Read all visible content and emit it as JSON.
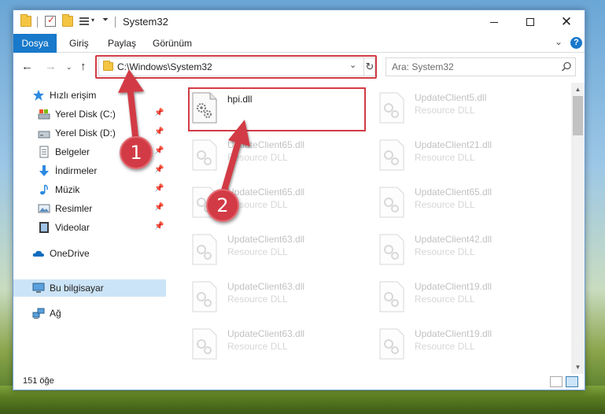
{
  "window": {
    "title": "System32"
  },
  "ribbon": {
    "tabs": [
      "Dosya",
      "Giriş",
      "Paylaş",
      "Görünüm"
    ]
  },
  "address": {
    "path": "C:\\Windows\\System32"
  },
  "search": {
    "placeholder": "Ara: System32"
  },
  "sidebar": {
    "quick_access": "Hızlı erişim",
    "items": [
      {
        "label": "Yerel Disk (C:)",
        "icon": "drive-icon",
        "pinned": true
      },
      {
        "label": "Yerel Disk (D:)",
        "icon": "drive-icon",
        "pinned": true
      },
      {
        "label": "Belgeler",
        "icon": "documents-icon",
        "pinned": true
      },
      {
        "label": "İndirmeler",
        "icon": "downloads-icon",
        "pinned": true
      },
      {
        "label": "Müzik",
        "icon": "music-icon",
        "pinned": true
      },
      {
        "label": "Resimler",
        "icon": "pictures-icon",
        "pinned": true
      },
      {
        "label": "Videolar",
        "icon": "videos-icon",
        "pinned": true
      }
    ],
    "onedrive": "OneDrive",
    "this_pc": "Bu bilgisayar",
    "network": "Ağ"
  },
  "files": {
    "main": {
      "name": "hpi.dll",
      "type": ""
    },
    "faded_left": [
      {
        "name": "UpdateClient65.dll",
        "type": "Resource DLL"
      },
      {
        "name": "UpdateClient65.dll",
        "type": "Resource DLL"
      },
      {
        "name": "UpdateClient63.dll",
        "type": "Resource DLL"
      },
      {
        "name": "UpdateClient63.dll",
        "type": "Resource DLL"
      },
      {
        "name": "UpdateClient63.dll",
        "type": "Resource DLL"
      }
    ],
    "faded_right": [
      {
        "name": "UpdateClient5.dll",
        "type": "Resource DLL"
      },
      {
        "name": "UpdateClient21.dll",
        "type": "Resource DLL"
      },
      {
        "name": "UpdateClient65.dll",
        "type": "Resource DLL"
      },
      {
        "name": "UpdateClient42.dll",
        "type": "Resource DLL"
      },
      {
        "name": "UpdateClient19.dll",
        "type": "Resource DLL"
      },
      {
        "name": "UpdateClient19.dll",
        "type": "Resource DLL"
      }
    ]
  },
  "status": {
    "item_count": "151 öğe"
  },
  "annotations": {
    "step1": "1",
    "step2": "2",
    "highlight_color": "#d23b45"
  },
  "colors": {
    "accent": "#1979ca",
    "selection": "#cce4f7"
  }
}
